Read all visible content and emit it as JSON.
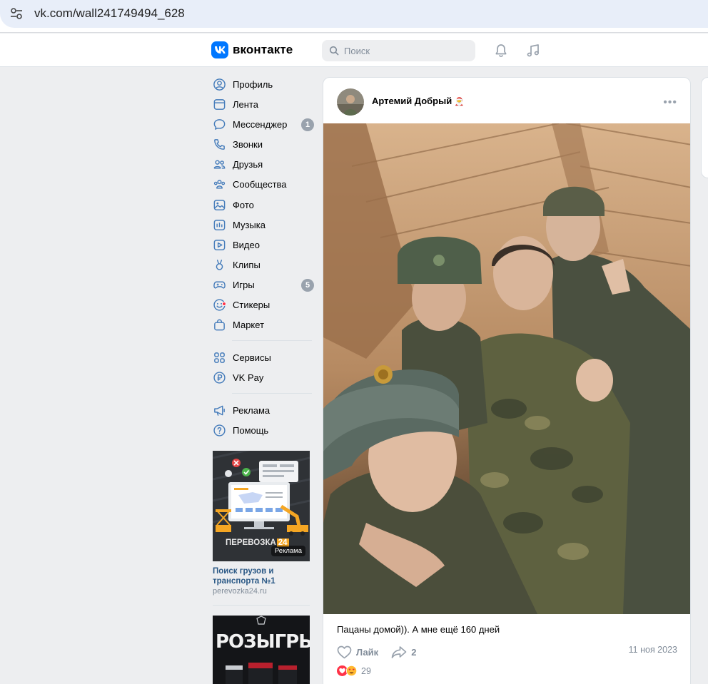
{
  "browser": {
    "url": "vk.com/wall241749494_628"
  },
  "header": {
    "logo_text": "вконтакте",
    "search_placeholder": "Поиск",
    "icons": [
      "bell-icon",
      "music-icon"
    ]
  },
  "nav": {
    "items": [
      {
        "label": "Профиль",
        "icon": "user-circle-icon"
      },
      {
        "label": "Лента",
        "icon": "feed-icon"
      },
      {
        "label": "Мессенджер",
        "icon": "message-icon",
        "badge": "1"
      },
      {
        "label": "Звонки",
        "icon": "phone-icon"
      },
      {
        "label": "Друзья",
        "icon": "friends-icon"
      },
      {
        "label": "Сообщества",
        "icon": "communities-icon"
      },
      {
        "label": "Фото",
        "icon": "photo-icon"
      },
      {
        "label": "Музыка",
        "icon": "music-icon"
      },
      {
        "label": "Видео",
        "icon": "video-icon"
      },
      {
        "label": "Клипы",
        "icon": "clips-icon"
      },
      {
        "label": "Игры",
        "icon": "gamepad-icon",
        "badge": "5"
      },
      {
        "label": "Стикеры",
        "icon": "smile-icon"
      },
      {
        "label": "Маркет",
        "icon": "bag-icon"
      },
      {
        "label": "Сервисы",
        "icon": "services-icon"
      },
      {
        "label": "VK Pay",
        "icon": "vkpay-icon"
      },
      {
        "label": "Реклама",
        "icon": "megaphone-icon"
      },
      {
        "label": "Помощь",
        "icon": "help-icon"
      }
    ]
  },
  "ads": {
    "ad1": {
      "banner_text": "ПЕРЕВОЗКА",
      "banner_number": "24",
      "label": "Реклама",
      "title": "Поиск грузов и транспорта №1",
      "domain": "perevozka24.ru"
    },
    "ad2": {
      "banner_text": "РОЗЫГРЫШ"
    }
  },
  "post": {
    "author": "Артемий Добрый",
    "author_emoji": "🎅",
    "text": "Пацаны домой)). А мне ещё 160 дней",
    "like_label": "Лайк",
    "share_count": "2",
    "date": "11 ноя 2023",
    "reactions_count": "29"
  },
  "colors": {
    "accent": "#0077ff",
    "link": "#2a5885",
    "secondary_text": "#818c99",
    "page_bg": "#edeef0"
  }
}
